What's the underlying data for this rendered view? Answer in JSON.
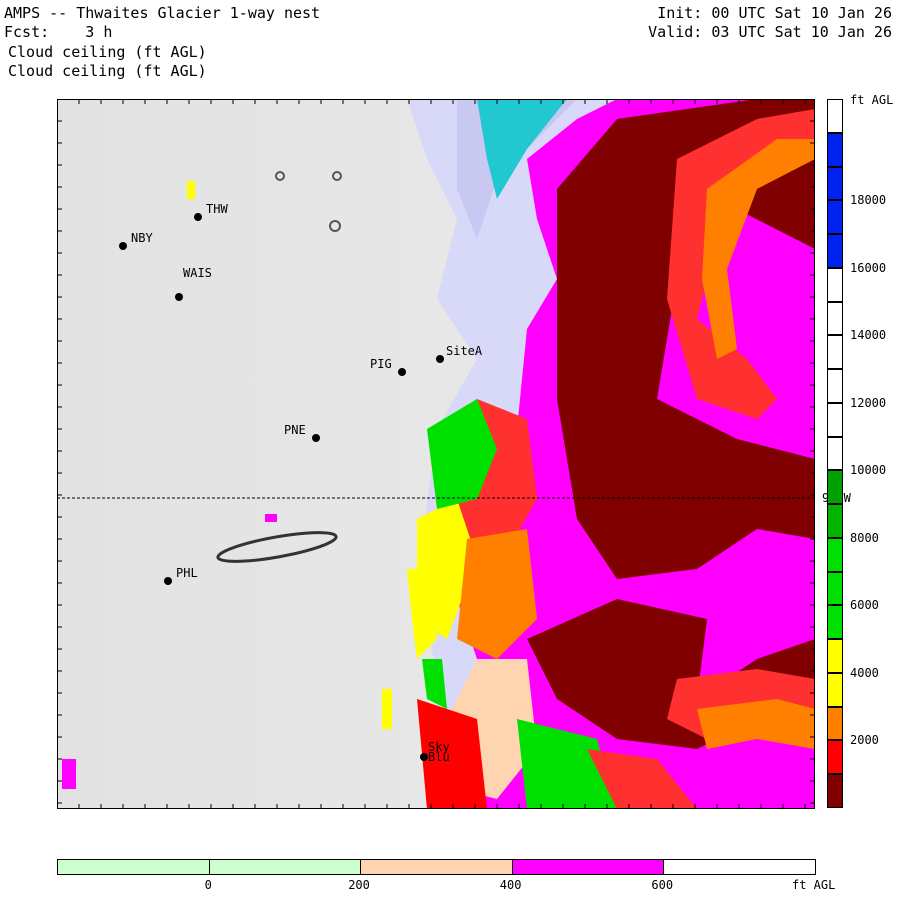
{
  "header": {
    "title": "AMPS -- Thwaites Glacier 1-way nest",
    "forecast": "Fcst:    3 h",
    "field_line1": "Cloud ceiling (ft AGL)",
    "field_line2": "Cloud ceiling (ft AGL)",
    "init": "Init: 00 UTC Sat 10 Jan 26",
    "valid": "Valid: 03 UTC Sat 10 Jan 26"
  },
  "map": {
    "stations": [
      {
        "name": "THW",
        "lon_label": ""
      },
      {
        "name": "NBY"
      },
      {
        "name": "WAIS"
      },
      {
        "name": "SiteA"
      },
      {
        "name": "PIG"
      },
      {
        "name": "PNE"
      },
      {
        "name": "PHL"
      },
      {
        "name": "Sky Blu"
      }
    ],
    "meridian_label": "90 W"
  },
  "colorbar": {
    "units": "ft AGL",
    "labels": [
      "18000",
      "16000",
      "14000",
      "12000",
      "10000",
      "8000",
      "6000",
      "4000",
      "2000"
    ],
    "colors_top_to_bottom": [
      "#ffffff",
      "#0022ee",
      "#0022ee",
      "#0022ee",
      "#0022ee",
      "#ffffff",
      "#ffffff",
      "#ffffff",
      "#ffffff",
      "#ffffff",
      "#ffffff",
      "#00a000",
      "#00b400",
      "#00e000",
      "#00e000",
      "#00e000",
      "#ffff00",
      "#ffff00",
      "#ff8000",
      "#ff0000",
      "#800000"
    ]
  },
  "bottom_bar": {
    "units": "ft AGL",
    "labels": [
      "0",
      "200",
      "400",
      "600"
    ],
    "colors": [
      "#ccffcc",
      "#ccffcc",
      "#ffd4b0",
      "#ff00ff",
      "#ffffff"
    ]
  }
}
